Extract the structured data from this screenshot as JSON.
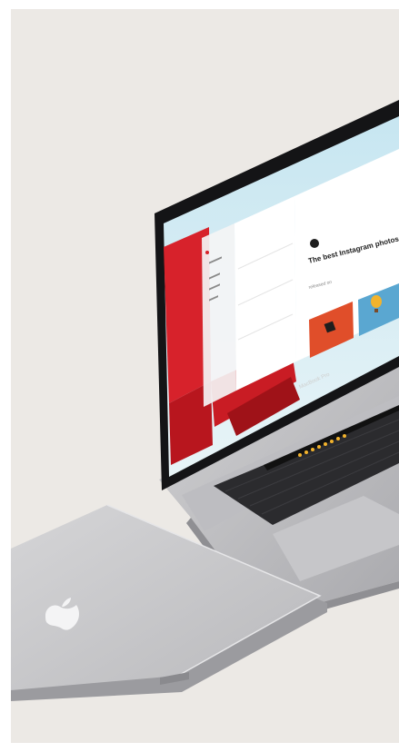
{
  "scene": {
    "background_color": "#ece9e5",
    "foreground_device": "laptop-open",
    "background_device": "laptop-closed"
  },
  "screen": {
    "headline": "The best Instagram photos",
    "sublabel": "released on",
    "brand_label": "MacBook Pro",
    "colors": {
      "accent_red": "#d7222b",
      "sky": "#bfe2ee",
      "photo_orange": "#e04e2a",
      "photo_blue": "#5aa7d1"
    }
  },
  "icons": {
    "closed_lid_logo": "apple-logo-icon",
    "open_app_logo": "app-logo-icon"
  }
}
